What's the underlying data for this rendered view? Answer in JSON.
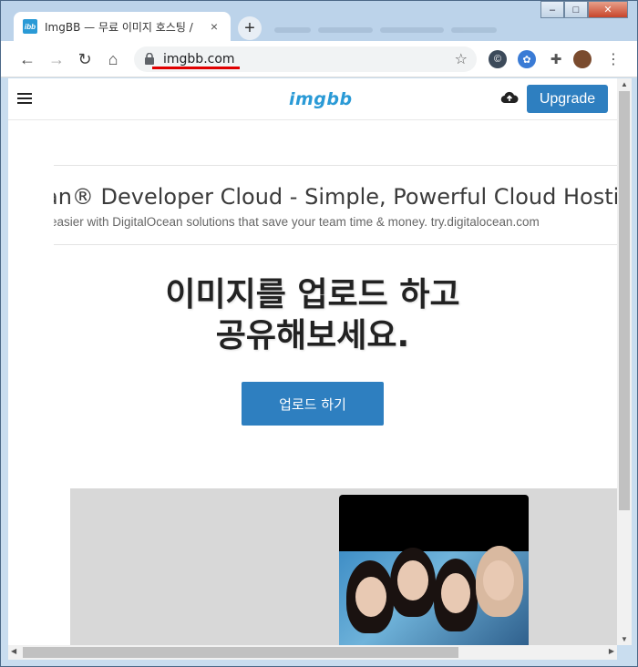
{
  "browser": {
    "tab": {
      "favicon_text": "ibb",
      "title": "ImgBB — 무료 이미지 호스팅 /",
      "close": "×"
    },
    "new_tab": "+",
    "url": "imgbb.com",
    "nav": {
      "back": "←",
      "forward": "→",
      "reload": "↻",
      "home": "⌂"
    },
    "star": "☆",
    "menu": "⋮",
    "window_controls": {
      "minimize": "–",
      "maximize": "□",
      "close": "✕"
    }
  },
  "site": {
    "logo": "imgbb",
    "upgrade_label": "Upgrade",
    "ad": {
      "title": "an® Developer Cloud - Simple, Powerful Cloud Hostin",
      "desc": "easier with DigitalOcean solutions that save your team time & money. try.digitalocean.com"
    },
    "hero": {
      "line1": "이미지를 업로드 하고",
      "line2": "공유해보세요."
    },
    "upload_label": "업로드 하기"
  },
  "colors": {
    "accent": "#2e7fc0",
    "logo": "#2a9ad6",
    "url_underline": "#e00000"
  }
}
